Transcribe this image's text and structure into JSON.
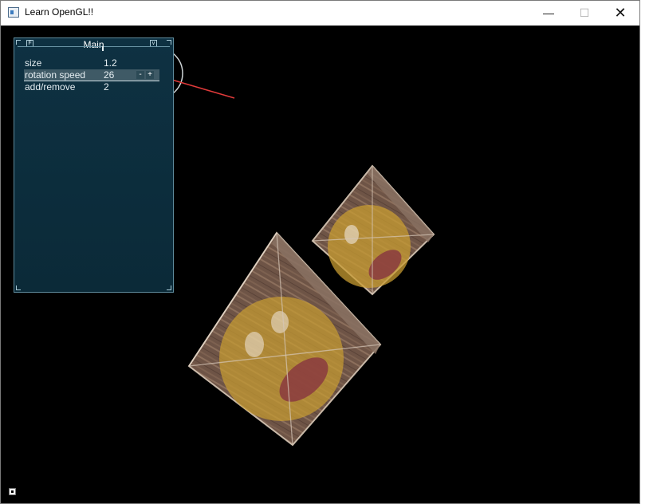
{
  "window": {
    "title": "Learn OpenGL!!",
    "controls": {
      "minimize": "—",
      "maximize": "☐",
      "close": "✕"
    }
  },
  "panel": {
    "title": "Main",
    "title_buttons": {
      "left": "F",
      "right": "v"
    },
    "rows": [
      {
        "label": "size",
        "value": "1.2"
      },
      {
        "label": "rotation speed",
        "value": "26",
        "decrement": "-",
        "increment": "+"
      },
      {
        "label": "add/remove",
        "value": "2"
      }
    ]
  },
  "annotation": {
    "color": "#e03a3a",
    "circle_color": "#cfd6d8"
  },
  "scene": {
    "objects": "textured-crates",
    "count_visible": 2
  }
}
